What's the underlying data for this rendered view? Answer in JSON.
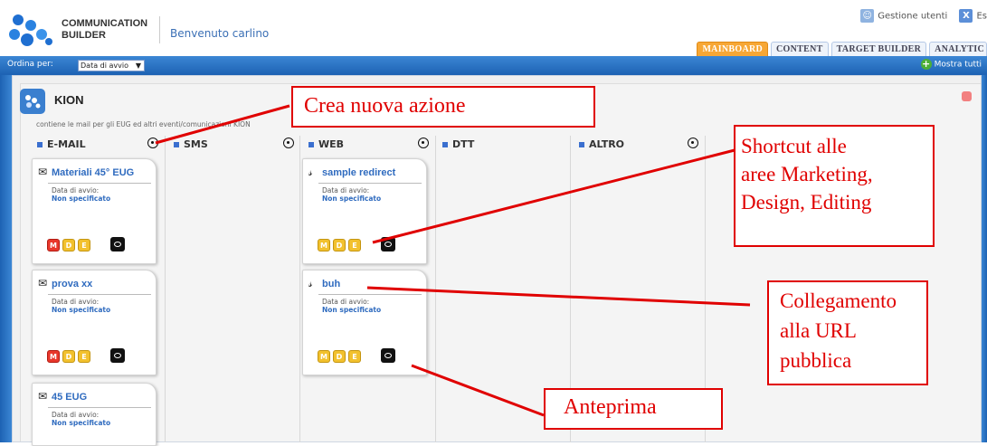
{
  "header": {
    "logo_line1": "COMMUNICATION",
    "logo_line2": "BUILDER",
    "welcome": "Benvenuto carlino",
    "user_mgmt": "Gestione utenti",
    "exit_truncated": "Es",
    "tabs": [
      "MAINBOARD",
      "CONTENT",
      "TARGET BUILDER",
      "ANALYTIC"
    ],
    "active_tab": "MAINBOARD"
  },
  "toolbar": {
    "order_label": "Ordina per:",
    "order_value": "Data di avvio",
    "show_all": "Mostra tutti"
  },
  "project": {
    "title": "KION",
    "description": "contiene le mail per gli EUG ed altri eventi/comunicazioni KION"
  },
  "columns": [
    {
      "name": "E-MAIL"
    },
    {
      "name": "SMS"
    },
    {
      "name": "WEB"
    },
    {
      "name": "DTT"
    },
    {
      "name": "ALTRO"
    }
  ],
  "cards": {
    "date_label": "Data di avvio:",
    "date_value": "Non specificato",
    "email": [
      {
        "title": "Materiali 45° EUG"
      },
      {
        "title": "prova xx"
      },
      {
        "title": "45 EUG"
      }
    ],
    "web": [
      {
        "title": "sample redirect"
      },
      {
        "title": "buh"
      }
    ],
    "button_m": "M",
    "button_d": "D",
    "button_e": "E"
  },
  "annotations": {
    "crea": "Crea nuova azione",
    "shortcut": [
      "Shortcut alle",
      "aree Marketing,",
      "Design, Editing"
    ],
    "collegamento": [
      "Collegamento",
      "alla URL",
      "pubblica"
    ],
    "anteprima": "Anteprima"
  },
  "colors": {
    "accent_blue": "#1d62b3",
    "tab_active": "#f7a735",
    "annotation_red": "#e00000",
    "button_red": "#e8372b",
    "button_yellow": "#f2c12e"
  },
  "icons": [
    "logo-icon",
    "users-icon",
    "exit-icon",
    "plus-icon",
    "envelope-icon",
    "web-link-icon",
    "eye-icon",
    "add-circle-icon",
    "close-icon",
    "project-icon"
  ]
}
